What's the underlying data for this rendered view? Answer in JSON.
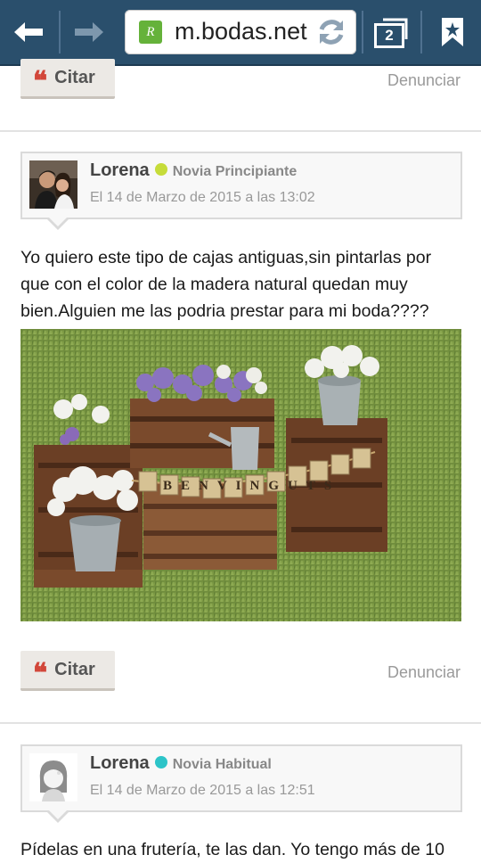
{
  "browser": {
    "url": "m.bodas.net",
    "tab_count": "2",
    "site_logo_letter": "R",
    "theme_color": "#2a4f6c"
  },
  "post_actions": {
    "cite_label": "Citar",
    "report_label": "Denunciar"
  },
  "posts": [
    {
      "author": "Lorena",
      "status_color": "#c6dc3a",
      "rank": "Novia Principiante",
      "date": "El 14 de Marzo de 2015 a las 13:02",
      "text": "Yo quiero este tipo de cajas antiguas,sin pintarlas por que con el color de la madera natural quedan muy bien.Alguien me las podria prestar para mi boda????",
      "has_photo": true,
      "banner_text": "BENVINGUTS"
    },
    {
      "author": "Lorena",
      "status_color": "#2dc4c8",
      "rank": "Novia Habitual",
      "date": "El 14 de Marzo de 2015 a las 12:51",
      "text": "Pídelas en una frutería, te las dan. Yo tengo más de 10"
    }
  ],
  "icons": [
    "back-arrow-icon",
    "forward-arrow-icon",
    "reload-icon",
    "tabs-icon",
    "bookmark-icon",
    "quote-icon"
  ]
}
